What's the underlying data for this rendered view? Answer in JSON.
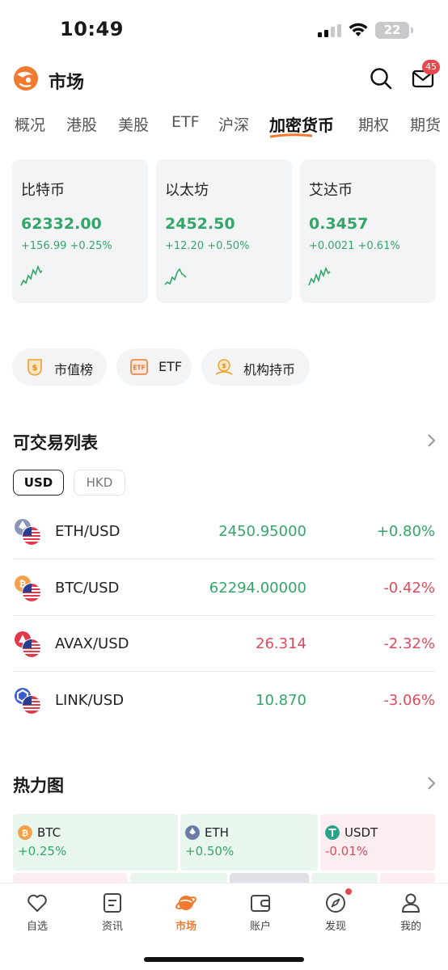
{
  "status_bar": {
    "time": "10:49",
    "battery": "22"
  },
  "header": {
    "title": "市场",
    "mail_badge": "45"
  },
  "tabs": [
    "概况",
    "港股",
    "美股",
    "ETF",
    "沪深",
    "加密货币",
    "期权",
    "期货"
  ],
  "active_tab": "加密货币",
  "cards": [
    {
      "name": "比特币",
      "price": "62332.00",
      "change": "+156.99 +0.25%"
    },
    {
      "name": "以太坊",
      "price": "2452.50",
      "change": "+12.20 +0.50%"
    },
    {
      "name": "艾达币",
      "price": "0.3457",
      "change": "+0.0021 +0.61%"
    }
  ],
  "shortcuts": [
    {
      "label": "市值榜",
      "icon": "market-cap-icon"
    },
    {
      "label": "ETF",
      "icon": "etf-icon"
    },
    {
      "label": "机构持币",
      "icon": "institution-holdings-icon"
    }
  ],
  "tradable": {
    "title": "可交易列表",
    "currencies": [
      "USD",
      "HKD"
    ],
    "selected_currency": "USD",
    "rows": [
      {
        "pair": "ETH/USD",
        "price": "2450.95000",
        "change": "+0.80%",
        "price_dir": "up",
        "change_dir": "up"
      },
      {
        "pair": "BTC/USD",
        "price": "62294.00000",
        "change": "-0.42%",
        "price_dir": "up",
        "change_dir": "down"
      },
      {
        "pair": "AVAX/USD",
        "price": "26.314",
        "change": "-2.32%",
        "price_dir": "down",
        "change_dir": "down"
      },
      {
        "pair": "LINK/USD",
        "price": "10.870",
        "change": "-3.06%",
        "price_dir": "up",
        "change_dir": "down"
      }
    ]
  },
  "heatmap": {
    "title": "热力图",
    "tiles": [
      {
        "name": "BTC",
        "change": "+0.25%",
        "dir": "up"
      },
      {
        "name": "ETH",
        "change": "+0.50%",
        "dir": "up"
      },
      {
        "name": "USDT",
        "change": "-0.01%",
        "dir": "down"
      }
    ]
  },
  "bottom_nav": [
    "自选",
    "资讯",
    "市场",
    "账户",
    "发现",
    "我的"
  ],
  "active_nav": "市场",
  "colors": {
    "up": "#33a66a",
    "down": "#e04a5c",
    "accent": "#f07a30"
  }
}
